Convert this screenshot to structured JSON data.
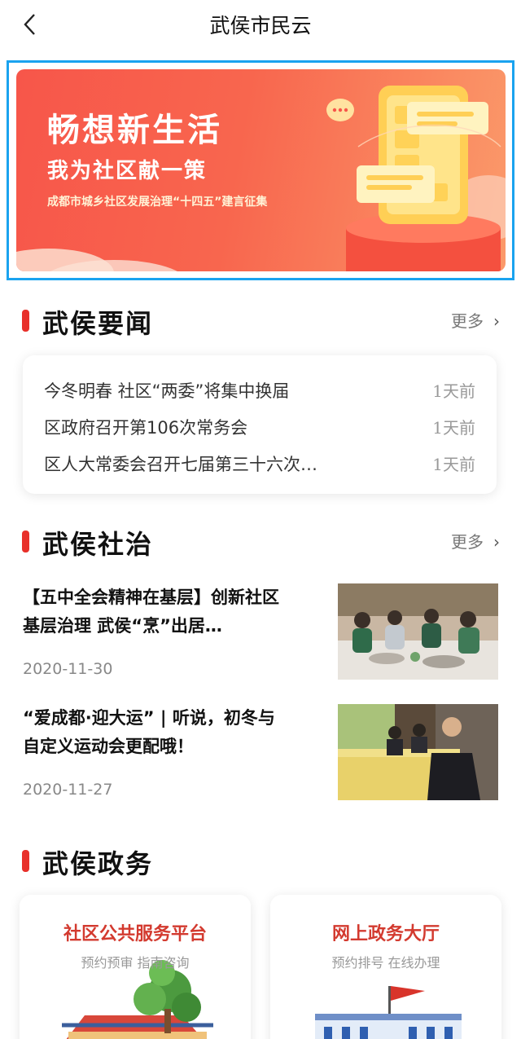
{
  "header": {
    "title": "武侯市民云",
    "back_icon": "chevron-left-icon"
  },
  "banner": {
    "headline": "畅想新生活",
    "subheadline": "我为社区献一策",
    "caption": "成都市城乡社区发展治理“十四五”建言征集",
    "colors": {
      "start": "#f7564a",
      "end": "#fb9a6a",
      "frame": "#1aa3ef"
    }
  },
  "news_section": {
    "title": "武侯要闻",
    "more_label": "更多",
    "items": [
      {
        "title": "今冬明春 社区“两委”将集中换届",
        "time": "1天前"
      },
      {
        "title": "区政府召开第106次常务会",
        "time": "1天前"
      },
      {
        "title": "区人大常委会召开七届第三十六次…",
        "time": "1天前"
      }
    ]
  },
  "community_section": {
    "title": "武侯社治",
    "more_label": "更多",
    "articles": [
      {
        "title": "【五中全会精神在基层】创新社区基层治理 武侯“烹”出居…",
        "date": "2020-11-30"
      },
      {
        "title": "“爱成都·迎大运” | 听说，初冬与自定义运动会更配哦！",
        "date": "2020-11-27"
      }
    ]
  },
  "gov_section": {
    "title": "武侯政务",
    "cards": [
      {
        "title": "社区公共服务平台",
        "subtitle": "预约预审 指南咨询"
      },
      {
        "title": "网上政务大厅",
        "subtitle": "预约排号 在线办理"
      }
    ]
  },
  "accent_color": "#e8302a"
}
